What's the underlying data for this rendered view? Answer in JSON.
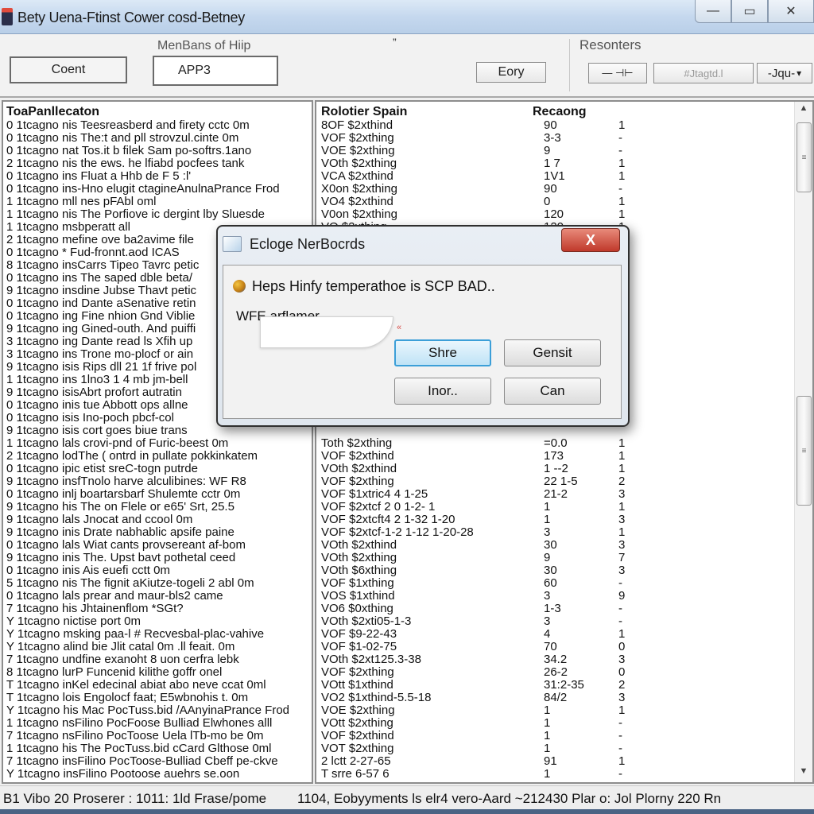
{
  "window": {
    "title": "Bety Uena-Ftinst Cower cosd-Betney",
    "controls": {
      "minimize": "—",
      "maximize": "▭",
      "close": "✕"
    }
  },
  "toolbar": {
    "group1_label": "MenBans of Hiip",
    "coent_button": "Coent",
    "app_field_value": "APP3",
    "eory_button": "Eory",
    "corner_mark": "”",
    "group2_label": "Resonters",
    "minus_plus_button": "—  ⊣⊢",
    "blurred_button": "#Jtagtd.l",
    "dropdown_value": "-Jqu-",
    "dropdown_arrow": "▾"
  },
  "left_pane": {
    "header": "ToaPanllecaton",
    "rows": [
      "0 1tcagno nis Teesreasberd and firety cctc 0m",
      "0 1tcagno nis The:t and pll strovzul.cinte 0m",
      "0 1tcagno nat Tos.it b filek Sam po-softrs.1ano",
      "2 1tcagno nis the ews. he lfiabd pocfees tank",
      "0 1tcagno ins Fluat a Hhb de F 5 :l'",
      "0 1tcagno ins-Hno elugit ctagineAnulnaPrance Frod",
      "1 1tcagno mll nes pFAbl oml",
      "1 1tcagno nis The Porfiove ic dergint lby Sluesde",
      "1 1tcagno msbperatt all",
      "2 1tcagno mefine ove ba2avime file",
      "0 1tcagno * Fud-fronnt.aod ICAS",
      "8 1tcagno insCarrs Tipeo Tavrc petic",
      "0 1tcagno ins The saped dble beta/",
      "9 1tcagno insdine Jubse Thavt petic",
      "0 1tcagno ind Dante aSenative retin",
      "0 1tcagno ing Fine nhion Gnd Viblie",
      "9 1tcagno ing Gined-outh. And puiffi",
      "3 1tcagno ing Dante read ls Xfih up",
      "3 1tcagno ins Trone mo-plocf or ain",
      "9 1tcagno isis Rips dll 21 1f frive pol",
      "1 1tcagno ins 1lno3 1 4 mb jm-bell",
      "9 1tcagno isisAbrt profort autratin",
      "0 1tcagno inis tue Abbott ops allne",
      "0 1tcagno isis Ino-poch pbcf-col",
      "9 1tcagno isis cort goes biue trans",
      "1 1tcagno lals crovi-pnd of Furic-beest 0m",
      "2 1tcagno lodThe ( ontrd in pullate pokkinkatem",
      "0 1tcagno ipic etist sreC-togn putrde",
      "9 1tcagno insfTnolo harve alculibines: WF R8",
      "0 1tcagno inlj boartarsbarf Shulemte cctr 0m",
      "9 1tcagno his The on Flele or e65' Srt, 25.5",
      "9 1tcagno lals Jnocat and ccool 0m",
      "9 1tcagno inis Drate nabhablic apsife paine",
      "0 1tcagno lals Wiat cants provsereant af-bom",
      "9 1tcagno inis The. Upst bavt pothetal ceed",
      "0 1tcagno inis Ais euefi cctt 0m",
      "5 1tcagno nis The fignit aKiutze-togeli 2 abl 0m",
      "0 1tcagno lals prear and maur-bls2 came",
      "7 1tcagno his Jhtainenflom *SGt?",
      "Y 1tcagno nictise port 0m",
      "Y 1tcagno msking paa-l # Recvesbal-plac-vahive",
      "Y 1tcagno alind bie Jlit catal 0m .ll feait. 0m",
      "7 1tcagno undfine exanoht 8 uon cerfra lebk",
      "8 1tcagno lurP Funcenid kilithe goffr onel",
      "T 1tcagno inKel edecinal abiat abo neve ccat 0ml",
      "T 1tcagno lois Engolocf faat; E5wbnohis t. 0m",
      "Y 1tcagno his Mac PocTuss.bid /AAnyinaPrance Frod",
      "1 1tcagno nsFilino PocFoose Bulliad Elwhones alll",
      "7 1tcagno nsFilino PocToose Uela lTb-mo be 0m",
      "1 1tcagno his The PocTuss.bid cCard Glthose 0ml",
      "7 1tcagno insFilino PocToose-Bulliad Cbeff pe-ckve",
      "Y 1tcagno insFilino Pootoose auehrs se.oon"
    ]
  },
  "right_pane": {
    "header_col1": "Rolotier Spain",
    "header_col2": "Recaong",
    "rows": [
      {
        "a": "8OF $2xthind",
        "b": "90",
        "c": "1"
      },
      {
        "a": "VOF $2xthing",
        "b": "3-3",
        "c": "-"
      },
      {
        "a": "VOE $2xthing",
        "b": "9",
        "c": "-"
      },
      {
        "a": "VOth $2xthing",
        "b": "1 7",
        "c": "1"
      },
      {
        "a": "VCA $2xthind",
        "b": "1V1",
        "c": "1"
      },
      {
        "a": "X0on $2xthing",
        "b": "90",
        "c": "-"
      },
      {
        "a": "VO4 $2xthind",
        "b": "0",
        "c": "1"
      },
      {
        "a": "V0on $2xthing",
        "b": "120",
        "c": "1"
      },
      {
        "a": "VO $2xthing",
        "b": "120",
        "c": "1"
      },
      {
        "a": "",
        "b": "",
        "c": ""
      },
      {
        "a": "",
        "b": "",
        "c": ""
      },
      {
        "a": "",
        "b": "",
        "c": ""
      },
      {
        "a": "",
        "b": "",
        "c": ""
      },
      {
        "a": "",
        "b": "",
        "c": ""
      },
      {
        "a": "",
        "b": "",
        "c": ""
      },
      {
        "a": "",
        "b": "",
        "c": ""
      },
      {
        "a": "",
        "b": "",
        "c": ""
      },
      {
        "a": "",
        "b": "",
        "c": ""
      },
      {
        "a": "",
        "b": "",
        "c": ""
      },
      {
        "a": "",
        "b": "",
        "c": ""
      },
      {
        "a": "",
        "b": "",
        "c": ""
      },
      {
        "a": "",
        "b": "",
        "c": ""
      },
      {
        "a": "",
        "b": "",
        "c": ""
      },
      {
        "a": "",
        "b": "",
        "c": ""
      },
      {
        "a": "",
        "b": "",
        "c": ""
      },
      {
        "a": "Toth $2xthing",
        "b": "=0.0",
        "c": "1"
      },
      {
        "a": "VOF $2xthind",
        "b": "173",
        "c": "1"
      },
      {
        "a": "VOth $2xthind",
        "b": "1 --2",
        "c": "1"
      },
      {
        "a": "VOF $2xthing",
        "b": "22 1-5",
        "c": "2"
      },
      {
        "a": "VOF $1xtric4 4 1-25",
        "b": "21-2",
        "c": "3"
      },
      {
        "a": "VOF $2xtcf 2 0 1-2- 1",
        "b": "1",
        "c": "1"
      },
      {
        "a": "VOF $2xtcft4 2 1-32 1-20",
        "b": "1",
        "c": "3"
      },
      {
        "a": "VOF $2xtcf-1-2 1-12 1-20-28",
        "b": "3",
        "c": "1"
      },
      {
        "a": "VOth $2xthind",
        "b": "30",
        "c": "3"
      },
      {
        "a": "VOth $2xthing",
        "b": "9",
        "c": "7"
      },
      {
        "a": "VOth $6xthing",
        "b": "30",
        "c": "3"
      },
      {
        "a": "VOF $1xthing",
        "b": "60",
        "c": "-"
      },
      {
        "a": "VOS $1xthind",
        "b": "3",
        "c": "9"
      },
      {
        "a": "VO6 $0xthing",
        "b": "1-3",
        "c": "-"
      },
      {
        "a": "VOth $2xti05-1-3",
        "b": "3",
        "c": "-"
      },
      {
        "a": "VOF $9-22-43",
        "b": "4",
        "c": "1"
      },
      {
        "a": "VOF $1-02-75",
        "b": "70",
        "c": "0"
      },
      {
        "a": "VOth $2xt125.3-38",
        "b": "34.2",
        "c": "3"
      },
      {
        "a": "VOF $2xthing",
        "b": "26-2",
        "c": "0"
      },
      {
        "a": "VOtt $1xthind",
        "b": "31:2-35",
        "c": "2"
      },
      {
        "a": "VO2 $1xthind-5.5-18",
        "b": "84/2",
        "c": "3"
      },
      {
        "a": "VOE $2xthing",
        "b": "1",
        "c": "1"
      },
      {
        "a": "VOtt $2xthing",
        "b": "1",
        "c": "-"
      },
      {
        "a": "VOF $2xthind",
        "b": "1",
        "c": "-"
      },
      {
        "a": "VOT $2xthing",
        "b": "1",
        "c": "-"
      },
      {
        "a": "2 lctt 2-27-65",
        "b": "91",
        "c": "1"
      },
      {
        "a": "T srre 6-57 6",
        "b": "1",
        "c": "-"
      }
    ],
    "scrollbar": {
      "up_arrow": "▲",
      "down_arrow": "▼",
      "thumb_grip": "≡"
    }
  },
  "dialog": {
    "title": "Ecloge NerBocrds",
    "close_label": "X",
    "message": "Heps Hinfy temperathoe is SCP BAD..",
    "field_label": "WFE arflamer",
    "field_value": "",
    "field_mark": "«",
    "buttons": {
      "shre": "Shre",
      "gensit": "Gensit",
      "inor": "Inor..",
      "can": "Can"
    }
  },
  "statusbar": {
    "left": "B1 Vibo 20 Proserer : 1011: 1ld Frase/pome",
    "right": "1104, Eobyyments ls elr4 vero-Aard ~212430 Plar o: Jol Plorny 220 Rn"
  }
}
